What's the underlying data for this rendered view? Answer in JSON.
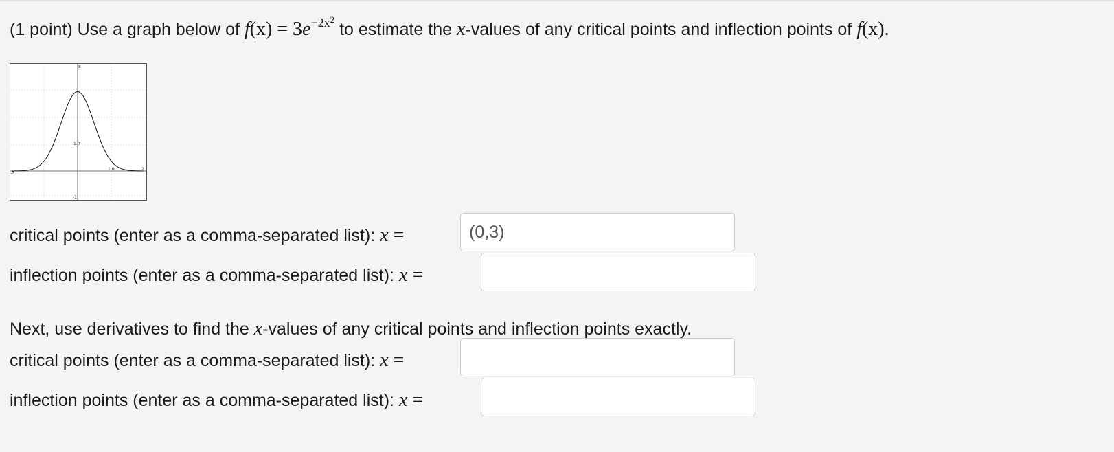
{
  "question": {
    "prefix": "(1 point) Use a graph below of",
    "func_name": "f",
    "func_arg": "(x)",
    "equals": "=",
    "coef": "3",
    "base": "e",
    "exp_text": "−2x",
    "exp_power": "2",
    "middle": "to estimate the",
    "xvar": "x",
    "suffix": "-values of any critical points and inflection points of",
    "end_func": "f",
    "end_arg": "(x)",
    "period": "."
  },
  "graph": {
    "tick_labels": {
      "y_top": "8",
      "y_mid": "1.0",
      "x_left": "-2",
      "x_mid": "1.0",
      "x_right": "2",
      "y_bottom": "-1"
    }
  },
  "part1": {
    "critical": {
      "label": "critical points (enter as a comma-separated list):",
      "var": "x",
      "eq": "=",
      "value": "(0,3)"
    },
    "inflection": {
      "label": "inflection points (enter as a comma-separated list):",
      "var": "x",
      "eq": "=",
      "value": ""
    }
  },
  "part2": {
    "intro_prefix": "Next, use derivatives to find the",
    "intro_var": "x",
    "intro_suffix": "-values of any critical points and inflection points exactly.",
    "critical": {
      "label": "critical points (enter as a comma-separated list):",
      "var": "x",
      "eq": "=",
      "value": ""
    },
    "inflection": {
      "label": "inflection points (enter as a comma-separated list):",
      "var": "x",
      "eq": "=",
      "value": ""
    }
  }
}
